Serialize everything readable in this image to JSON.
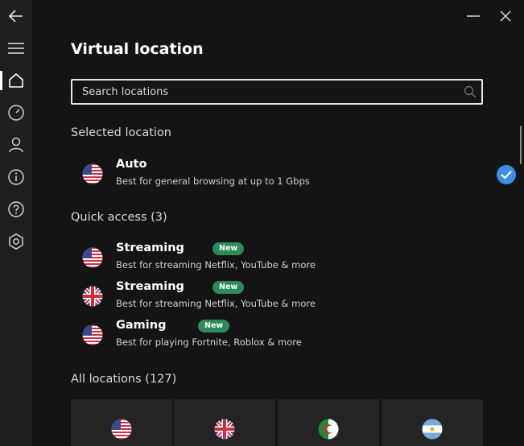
{
  "sidebar": {
    "items": [
      {
        "icon": "back-arrow-icon"
      },
      {
        "icon": "hamburger-menu-icon"
      },
      {
        "icon": "home-icon",
        "active": true
      },
      {
        "icon": "speed-gauge-icon"
      },
      {
        "icon": "account-icon"
      },
      {
        "icon": "info-icon"
      },
      {
        "icon": "help-icon"
      },
      {
        "icon": "settings-icon"
      }
    ]
  },
  "window": {
    "minimize_icon": "minimize-icon",
    "close_icon": "close-icon"
  },
  "page": {
    "title": "Virtual location"
  },
  "search": {
    "placeholder": "Search locations",
    "value": ""
  },
  "selected": {
    "heading": "Selected location",
    "item": {
      "name": "Auto",
      "description": "Best for general browsing at up to 1 Gbps",
      "flag": "us-flag-icon",
      "checked": true
    }
  },
  "quick_access": {
    "heading": "Quick access (3)",
    "items": [
      {
        "name": "Streaming",
        "badge": "New",
        "description": "Best for streaming Netflix, YouTube & more",
        "flag": "us-flag-icon"
      },
      {
        "name": "Streaming",
        "badge": "New",
        "description": "Best for streaming Netflix, YouTube & more",
        "flag": "uk-flag-icon"
      },
      {
        "name": "Gaming",
        "badge": "New",
        "description": "Best for playing Fortnite, Roblox & more",
        "flag": "us-flag-icon"
      }
    ]
  },
  "all_locations": {
    "heading": "All locations (127)",
    "tiles": [
      {
        "flag": "us-flag-icon"
      },
      {
        "flag": "uk-flag-icon"
      },
      {
        "flag": "algeria-flag-icon"
      },
      {
        "flag": "argentina-flag-icon"
      }
    ]
  },
  "colors": {
    "background": "#141414",
    "sidebar": "#1f1f1f",
    "badge": "#2e8b57",
    "check": "#3a8ee6",
    "tile": "#242424"
  }
}
